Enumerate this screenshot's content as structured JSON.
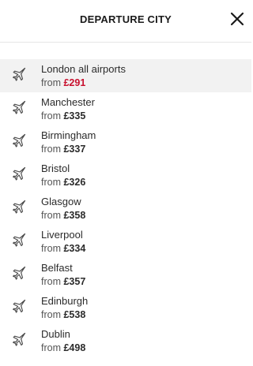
{
  "header": {
    "title": "DEPARTURE CITY",
    "close_icon": "close-icon"
  },
  "colors": {
    "highlight_price": "#c8102e",
    "selected_row_bg": "#f2f2f2",
    "text": "#2b2b2b"
  },
  "list": {
    "item_icon": "airplane-icon",
    "items": [
      {
        "city": "London all airports",
        "from": "from",
        "price": "£291",
        "selected": true
      },
      {
        "city": "Manchester",
        "from": "from",
        "price": "£335",
        "selected": false
      },
      {
        "city": "Birmingham",
        "from": "from",
        "price": "£337",
        "selected": false
      },
      {
        "city": "Bristol",
        "from": "from",
        "price": "£326",
        "selected": false
      },
      {
        "city": "Glasgow",
        "from": "from",
        "price": "£358",
        "selected": false
      },
      {
        "city": "Liverpool",
        "from": "from",
        "price": "£334",
        "selected": false
      },
      {
        "city": "Belfast",
        "from": "from",
        "price": "£357",
        "selected": false
      },
      {
        "city": "Edinburgh",
        "from": "from",
        "price": "£538",
        "selected": false
      },
      {
        "city": "Dublin",
        "from": "from",
        "price": "£498",
        "selected": false
      }
    ]
  }
}
